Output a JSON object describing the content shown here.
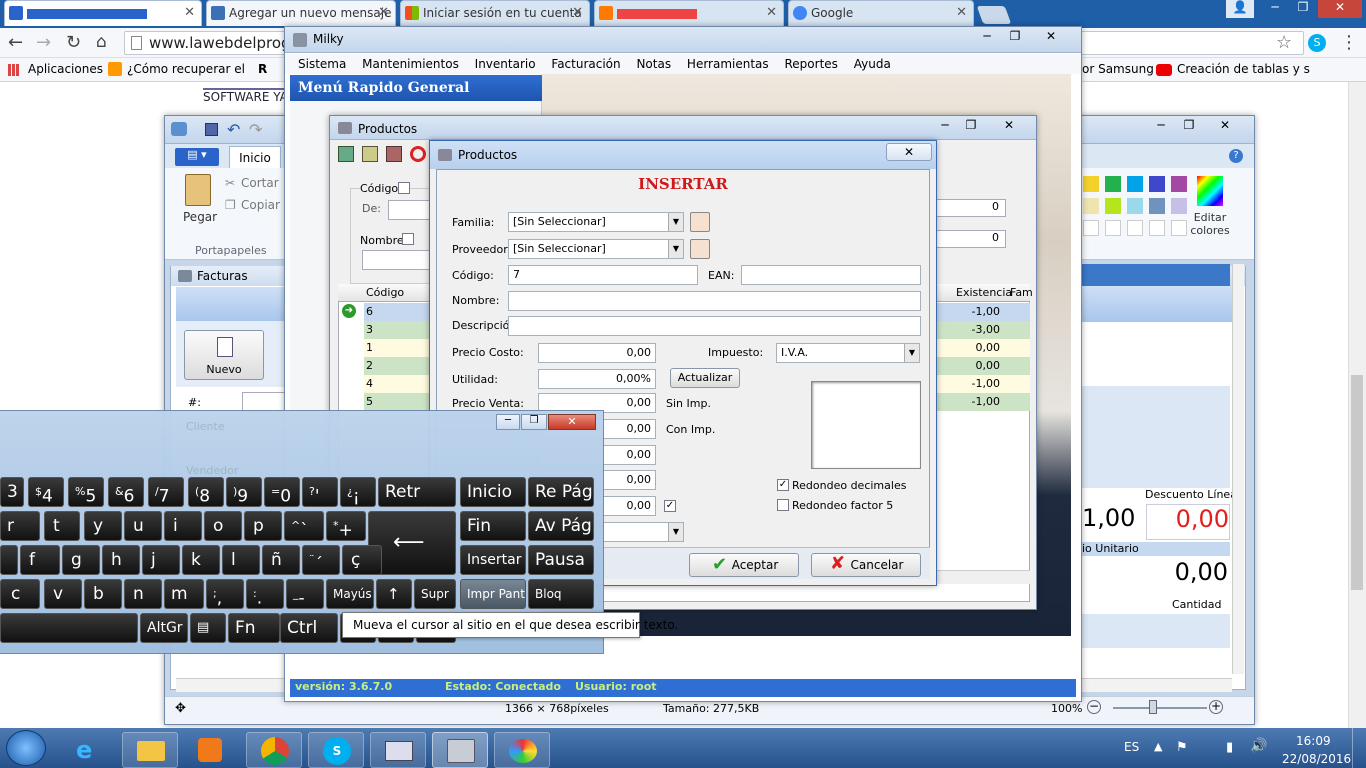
{
  "browser": {
    "tabs": [
      {
        "label": "",
        "color": "#2a63c9"
      },
      {
        "label": "Agregar un nuevo mensaje",
        "color": "#3b6fb6"
      },
      {
        "label": "Iniciar sesión en tu cuenta",
        "color": "#f25022"
      },
      {
        "label": "",
        "color": "#ff7a00"
      },
      {
        "label": "Google",
        "color": "#4285f4"
      }
    ],
    "address": "www.lawebdelprog",
    "bookmarks": [
      "Aplicaciones",
      "¿Cómo recuperar el c",
      "R"
    ],
    "bookmarks_right": [
      "or Samsung",
      "Creación de tablas y s"
    ],
    "page_text": [
      "SOFTWARE YA"
    ]
  },
  "paint": {
    "ribbon_tab": "Inicio",
    "paste": "Pegar",
    "cut": "Cortar",
    "copy": "Copiar",
    "group": "Portapapeles",
    "edit_colors": "Editar colores",
    "status_size": "1366 × 768píxeles",
    "status_file": "Tamaño: 277,5KB",
    "zoom": "100%"
  },
  "facturas": {
    "title": "Facturas",
    "new_button": "Nuevo",
    "hash": "#:",
    "descuento_linea": "Descuento Línea",
    "val1": "1,00",
    "val2": "0,00",
    "precio_unitario": "io Unitario",
    "val3": "0,00",
    "cantidad": "Cantidad"
  },
  "milky": {
    "title": "Milky",
    "menu": [
      "Sistema",
      "Mantenimientos",
      "Inventario",
      "Facturación",
      "Notas",
      "Herramientas",
      "Reportes",
      "Ayuda"
    ],
    "quick_menu": "Menú Rapido General",
    "status_version": "versión: 3.6.7.0",
    "status_estado": "Estado: Conectado",
    "status_usuario": "Usuario: root"
  },
  "productos_list": {
    "title": "Productos",
    "codigo_label": "Código",
    "de_label": "De:",
    "nombre_label": "Nombre",
    "right_val1": "0",
    "right_val2": "0",
    "col_codigo": "Código",
    "col_existencia": "Existencia",
    "col_fam": "Fam",
    "rows": [
      {
        "code": "6",
        "exist": "-1,00"
      },
      {
        "code": "3",
        "exist": "-3,00"
      },
      {
        "code": "1",
        "exist": "0,00"
      },
      {
        "code": "2",
        "exist": "0,00"
      },
      {
        "code": "4",
        "exist": "-1,00"
      },
      {
        "code": "5",
        "exist": "-1,00"
      }
    ]
  },
  "dialog": {
    "title": "Productos",
    "heading": "INSERTAR",
    "familia_label": "Familia:",
    "familia_value": "[Sin Seleccionar]",
    "proveedor_label": "Proveedor:",
    "proveedor_value": "[Sin Seleccionar]",
    "codigo_label": "Código:",
    "codigo_value": "7",
    "ean_label": "EAN:",
    "nombre_label": "Nombre:",
    "descripcion_label": "Descripción",
    "precio_costo_label": "Precio Costo:",
    "precio_costo_value": "0,00",
    "impuesto_label": "Impuesto:",
    "impuesto_value": "I.V.A.",
    "utilidad_label": "Utilidad:",
    "utilidad_value": "0,00%",
    "actualizar": "Actualizar",
    "precio_venta_label": "Precio Venta:",
    "precio_venta_value": "0,00",
    "sin_imp": "Sin Imp.",
    "val_con": "0,00",
    "con_imp": "Con Imp.",
    "val3": "0,00",
    "val4": "0,00",
    "val5": "0,00",
    "redondeo_decimales": "Redondeo decimales",
    "redondeo_factor": "Redondeo factor 5",
    "aceptar": "Aceptar",
    "cancelar": "Cancelar"
  },
  "keyboard": {
    "row1": [
      "3",
      "4",
      "5",
      "6",
      "7",
      "8",
      "9",
      "0",
      "'",
      "¡",
      "Retr"
    ],
    "row1_shift": [
      "",
      "$",
      "%",
      "&",
      "/",
      "(",
      ")",
      "=",
      "?",
      "¿",
      ""
    ],
    "row2": [
      "r",
      "t",
      "y",
      "u",
      "i",
      "o",
      "p",
      "`",
      "+"
    ],
    "row2_shift": [
      "",
      "",
      "",
      "",
      "",
      "",
      "",
      "^",
      "*"
    ],
    "row3": [
      "f",
      "g",
      "h",
      "j",
      "k",
      "l",
      "ñ",
      "´",
      "ç"
    ],
    "row3_shift": [
      "",
      "",
      "",
      "",
      "",
      "",
      "",
      "¨",
      ""
    ],
    "row4": [
      "c",
      "v",
      "b",
      "n",
      "m",
      ",",
      ".",
      "-"
    ],
    "row4_shift": [
      "",
      "",
      "",
      "",
      "",
      ";",
      ":",
      "_"
    ],
    "mayus": "Mayús",
    "supr": "Supr",
    "altgr": "AltGr",
    "fn": "Fn",
    "ctrl": "Ctrl",
    "nav": [
      "Inicio",
      "Re Pág",
      "Fin",
      "Av Pág",
      "Insertar",
      "Pausa",
      "Impr Pant",
      "Bloq Despl"
    ],
    "tooltip": "Mueva el cursor al sitio en el que desea escribir texto."
  },
  "taskbar": {
    "lang": "ES",
    "time": "16:09",
    "date": "22/08/2016"
  }
}
